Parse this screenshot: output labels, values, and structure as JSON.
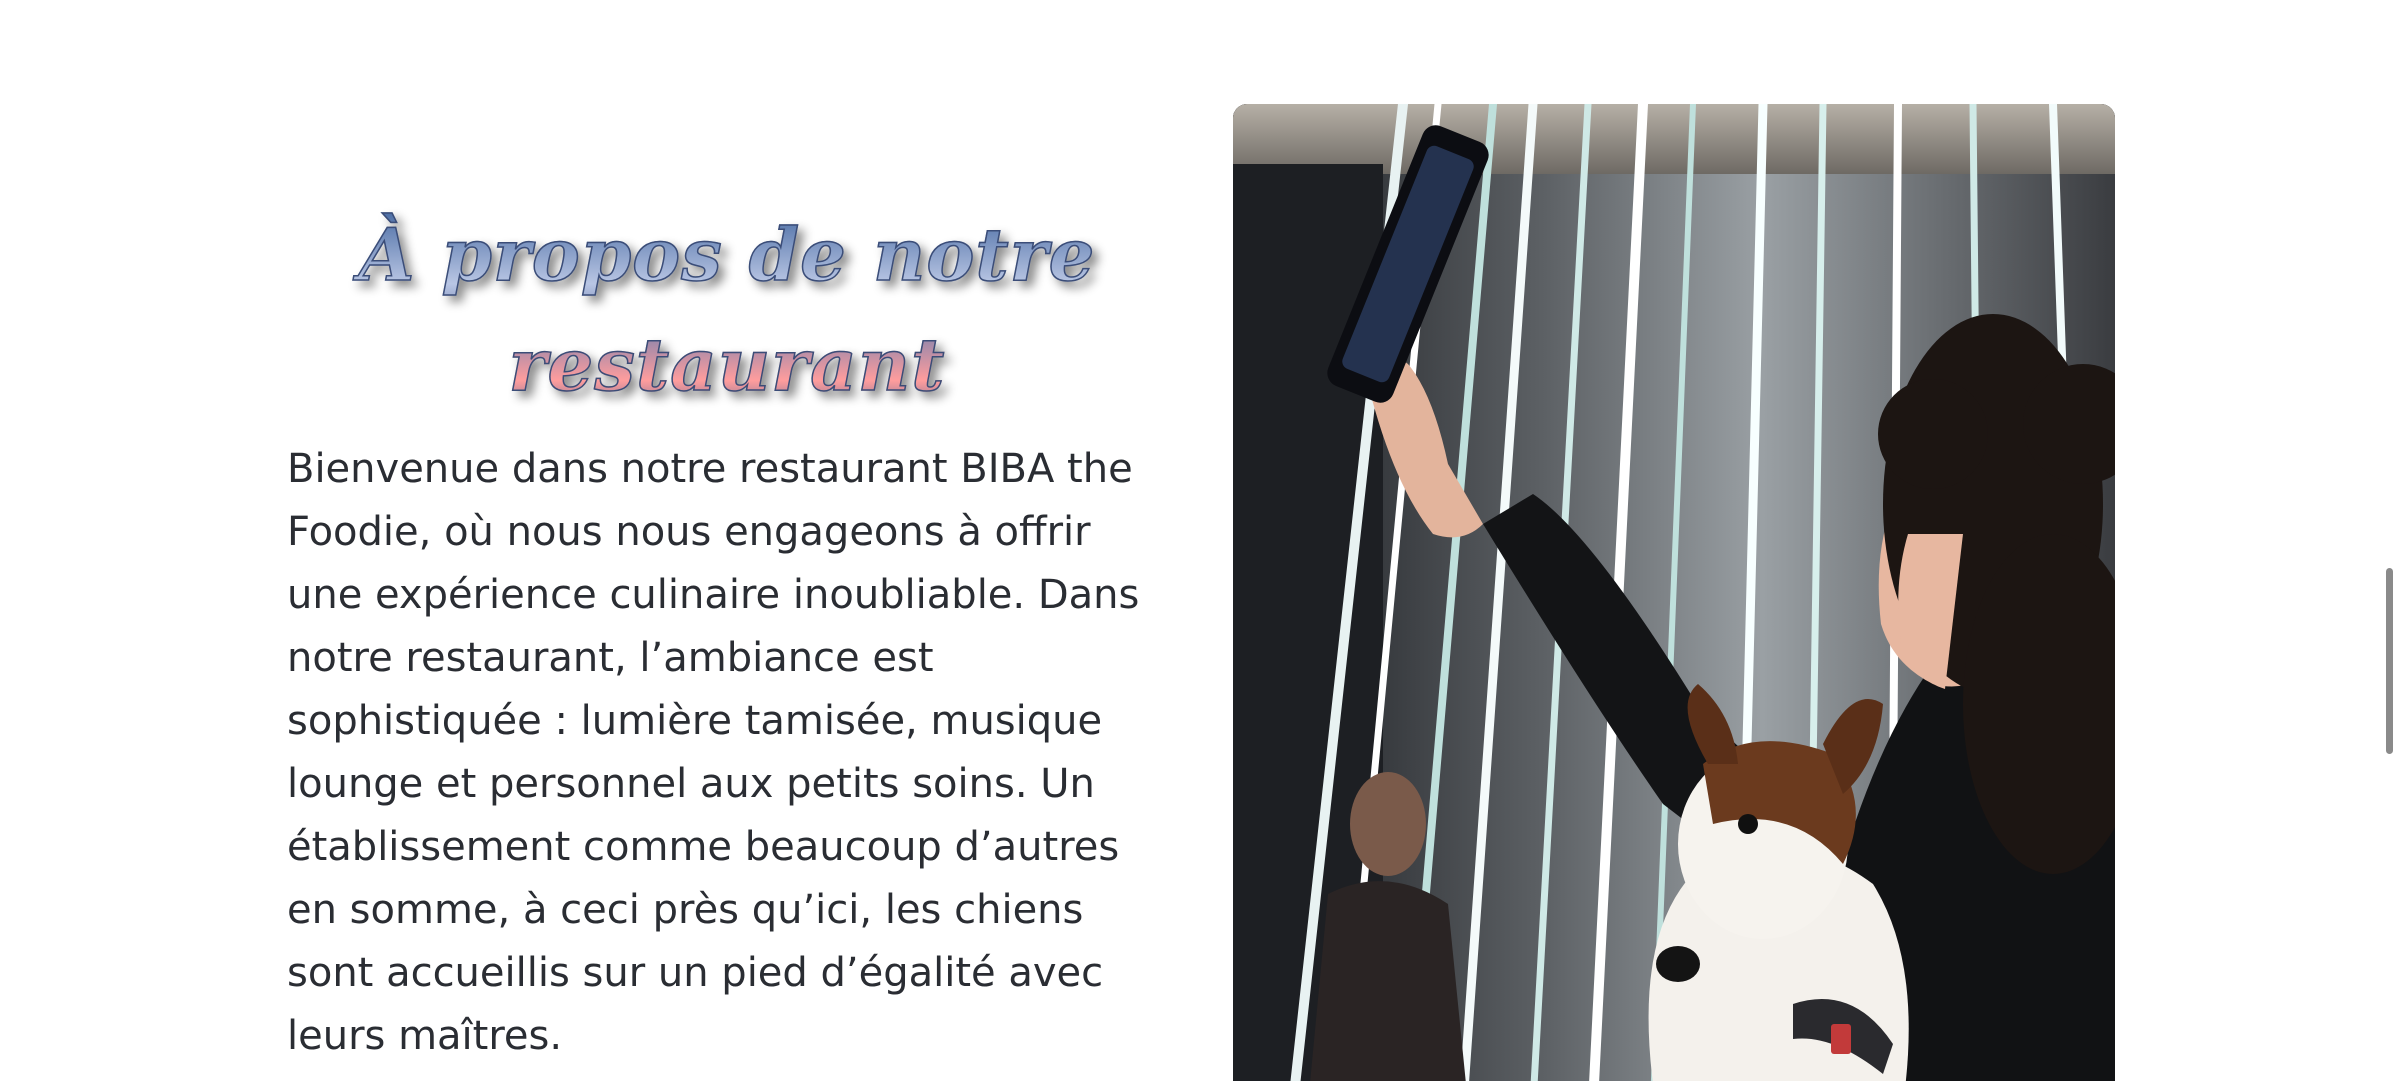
{
  "about": {
    "title": "À propos de notre restaurant",
    "body": "Bienvenue dans notre restaurant BIBA the Foodie, où nous nous engageons à offrir une expérience culinaire inoubliable. Dans notre restaurant, l’ambiance est sophistiquée : lumière tamisée, musique lounge et personnel aux petits soins. Un établissement comme beaucoup d’autres en somme, à ceci près qu’ici, les chiens sont accueillis sur un pied d’égalité avec leurs maîtres."
  },
  "photo": {
    "subject": "woman-taking-selfie-with-dog"
  }
}
